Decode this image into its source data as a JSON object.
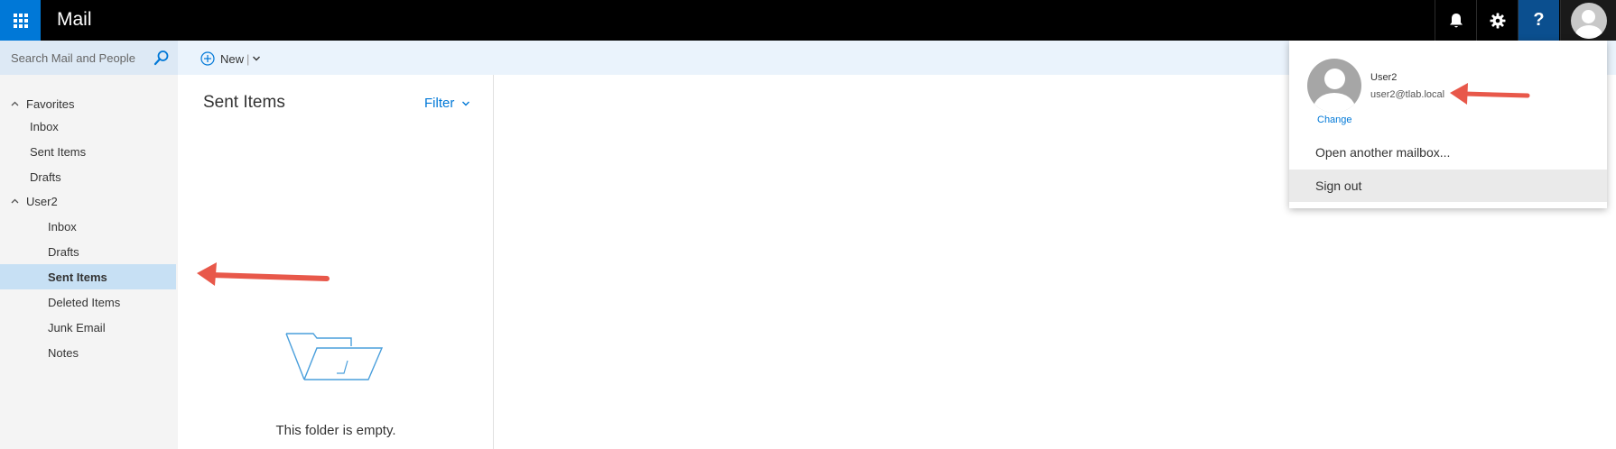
{
  "app": {
    "title": "Mail"
  },
  "topbar": {
    "icons": [
      "app-launcher-icon",
      "bell-icon",
      "gear-icon",
      "help-icon",
      "avatar-icon"
    ],
    "help_glyph": "?"
  },
  "search": {
    "placeholder": "Search Mail and People"
  },
  "commands": {
    "new_label": "New",
    "separator": "|"
  },
  "sidebar": {
    "favorites_label": "Favorites",
    "favorites": [
      {
        "label": "Inbox"
      },
      {
        "label": "Sent Items"
      },
      {
        "label": "Drafts"
      }
    ],
    "account_label": "User2",
    "account_folders": [
      {
        "label": "Inbox"
      },
      {
        "label": "Drafts"
      },
      {
        "label": "Sent Items",
        "selected": true
      },
      {
        "label": "Deleted Items"
      },
      {
        "label": "Junk Email"
      },
      {
        "label": "Notes"
      }
    ]
  },
  "message_list": {
    "folder_title": "Sent Items",
    "filter_label": "Filter",
    "empty_text": "This folder is empty."
  },
  "account_menu": {
    "name": "User2",
    "email": "user2@tlab.local",
    "change_label": "Change",
    "items": [
      {
        "label": "Open another mailbox..."
      },
      {
        "label": "Sign out",
        "highlighted": true
      }
    ]
  },
  "colors": {
    "accent": "#0078d7",
    "topbar": "#000000",
    "selected_nav": "#c7e0f4",
    "annotation_arrow": "#e8584a"
  }
}
